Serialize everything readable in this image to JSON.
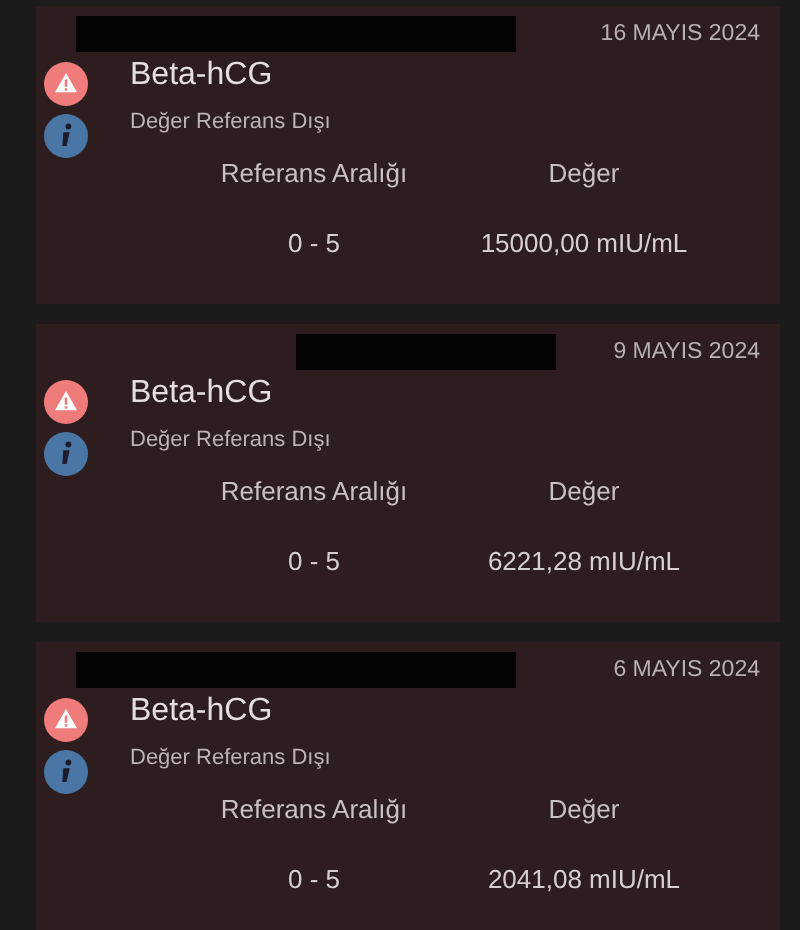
{
  "results": [
    {
      "date": "16 MAYIS 2024",
      "test": "Beta-hCG",
      "status": "Değer Referans Dışı",
      "columns": [
        "Referans Aralığı",
        "Değer"
      ],
      "range": "0 - 5",
      "value": "15000,00 mIU/mL"
    },
    {
      "date": "9 MAYIS 2024",
      "test": "Beta-hCG",
      "status": "Değer Referans Dışı",
      "columns": [
        "Referans Aralığı",
        "Değer"
      ],
      "range": "0 - 5",
      "value": "6221,28 mIU/mL"
    },
    {
      "date": "6 MAYIS 2024",
      "test": "Beta-hCG",
      "status": "Değer Referans Dışı",
      "columns": [
        "Referans Aralığı",
        "Değer"
      ],
      "range": "0 - 5",
      "value": "2041,08 mIU/mL"
    }
  ]
}
